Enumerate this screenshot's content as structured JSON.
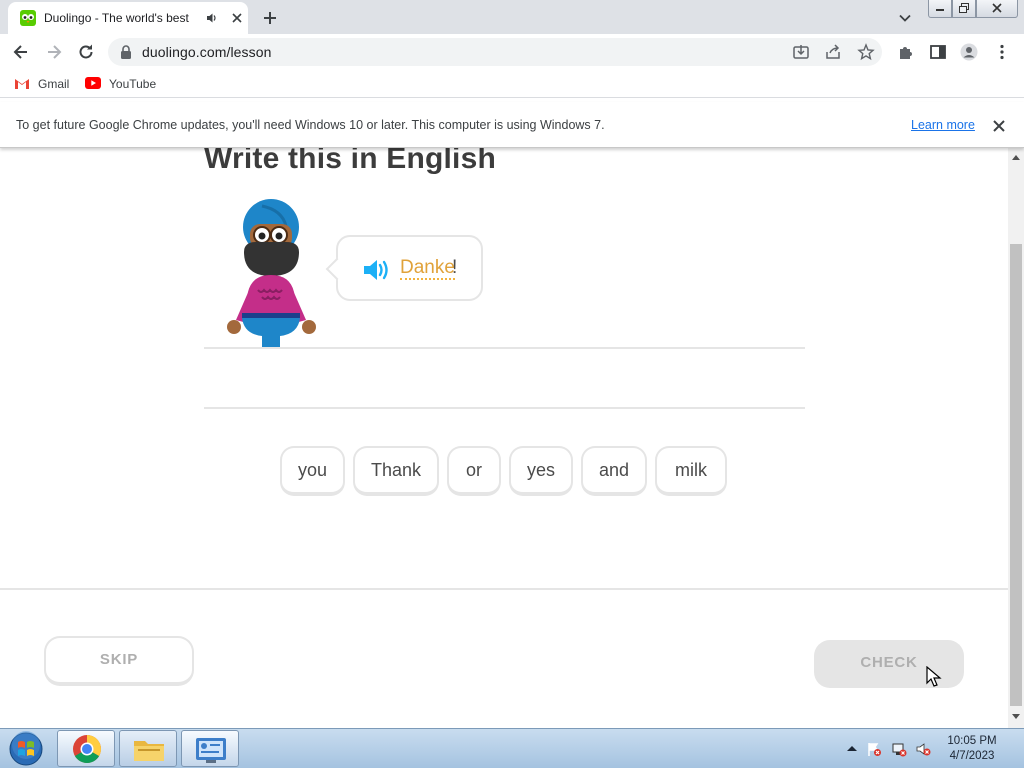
{
  "browser": {
    "tab": {
      "title": "Duolingo - The world's best",
      "favicon": "duolingo-owl-icon",
      "audio_icon": "speaker-icon",
      "close_icon": "close-icon"
    },
    "url": "duolingo.com/lesson",
    "bookmarks": [
      {
        "label": "Gmail",
        "icon": "gmail-icon"
      },
      {
        "label": "YouTube",
        "icon": "youtube-icon"
      }
    ],
    "infobar": {
      "message": "To get future Google Chrome updates, you'll need Windows 10 or later. This computer is using Windows 7.",
      "link": "Learn more"
    }
  },
  "lesson": {
    "heading": "Write this in English",
    "prompt_word": "Danke",
    "prompt_punct": "!",
    "word_bank": [
      "you",
      "Thank",
      "or",
      "yes",
      "and",
      "milk"
    ],
    "skip_label": "SKIP",
    "check_label": "CHECK"
  },
  "taskbar": {
    "time": "10:05 PM",
    "date": "4/7/2023",
    "apps": [
      "chrome-icon",
      "file-explorer-icon",
      "control-panel-icon"
    ]
  },
  "colors": {
    "duo_green": "#58cc02",
    "prompt_word": "#e0a23a",
    "speaker_blue": "#1cb0f6",
    "border_gray": "#e5e5e5",
    "disabled_text": "#afafaf",
    "link_blue": "#1a73e8"
  }
}
